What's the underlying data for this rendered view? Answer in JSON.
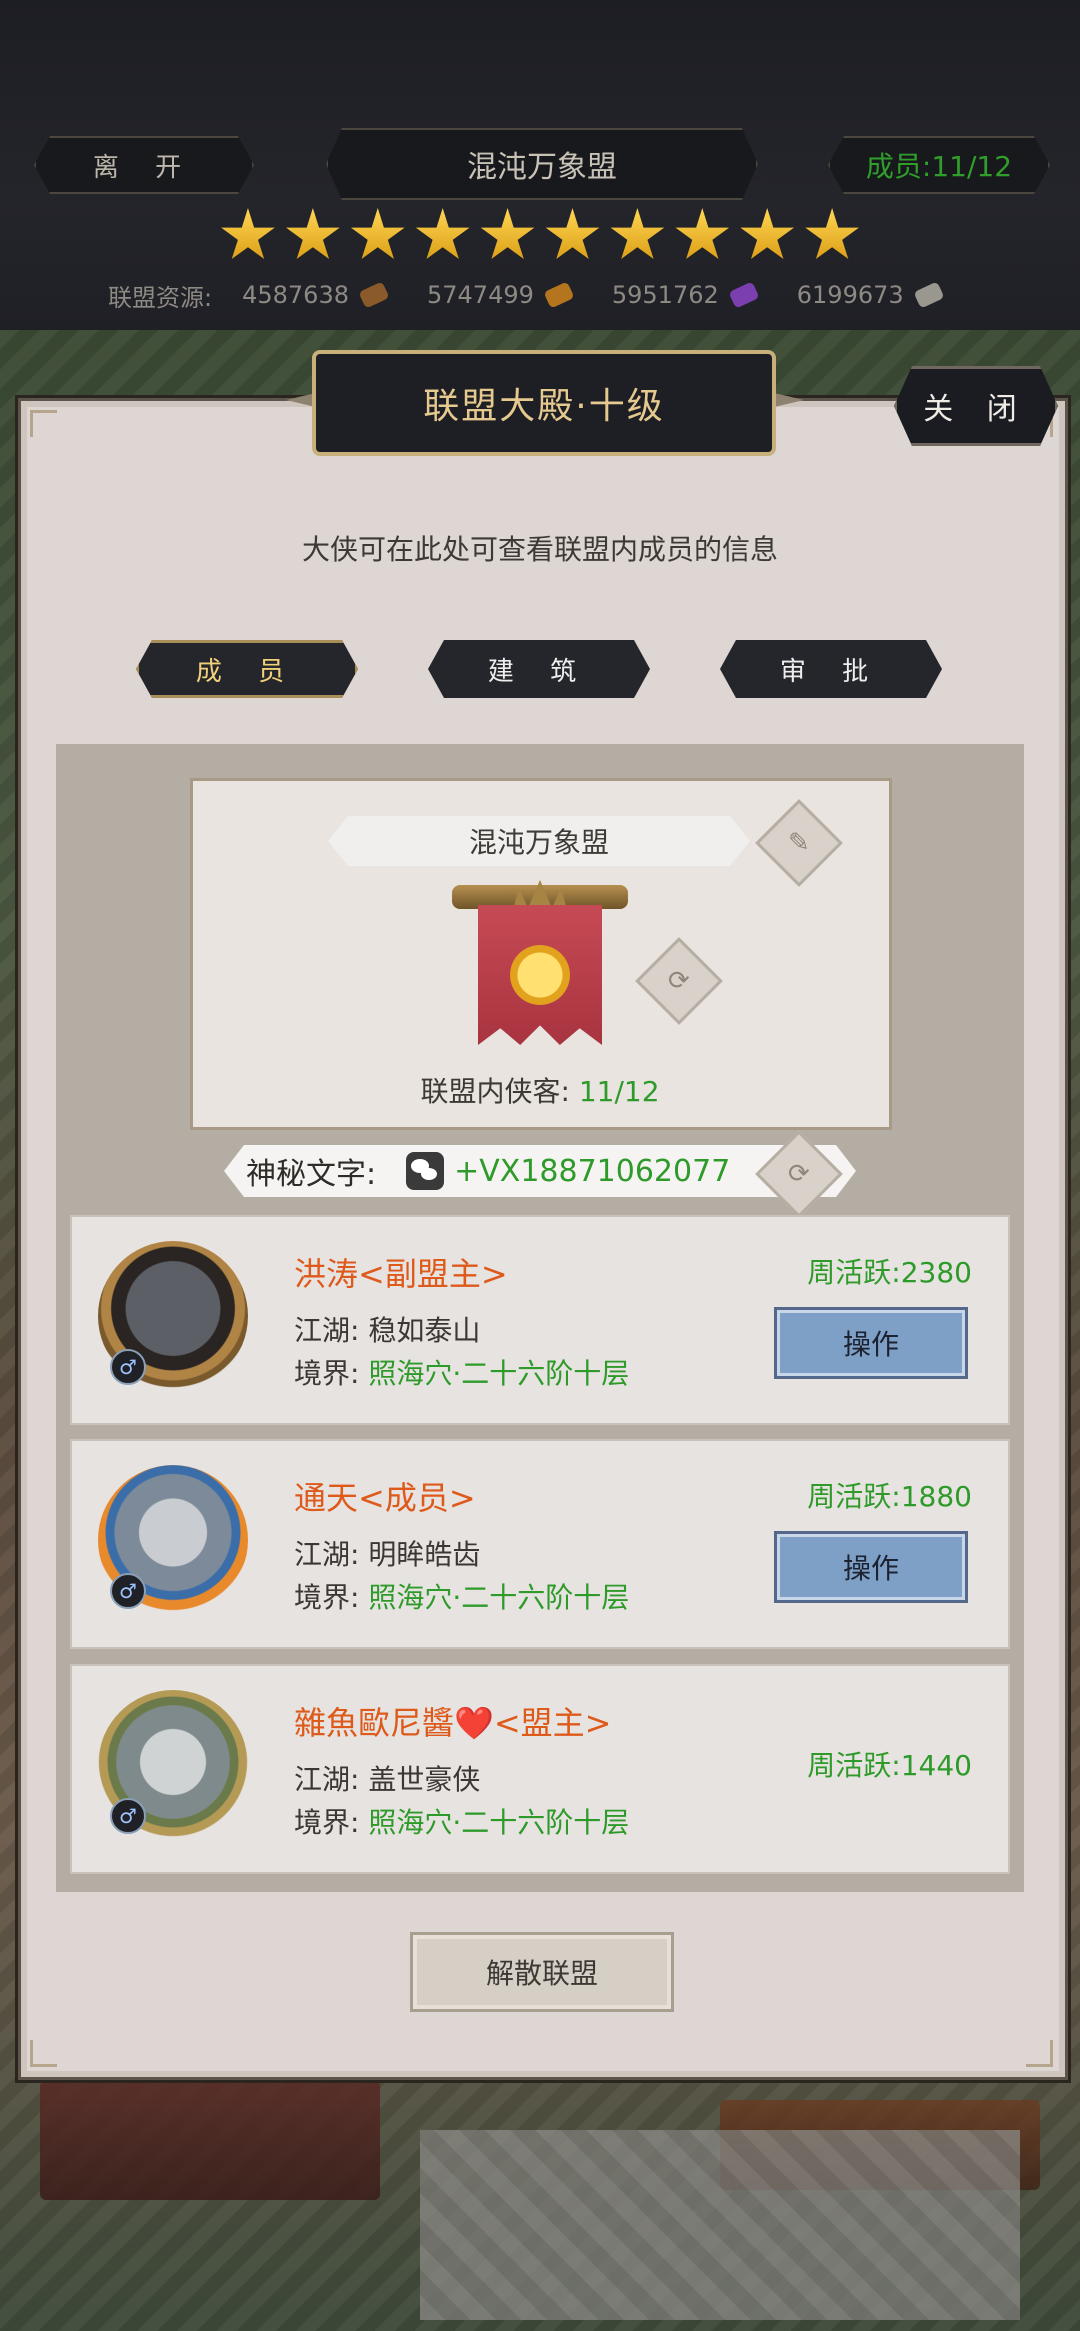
{
  "header": {
    "leave_label": "离 开",
    "alliance_name": "混沌万象盟",
    "member_count": "成员:11/12",
    "star_count": 10,
    "resources_label": "联盟资源:",
    "resources": [
      {
        "value": "4587638",
        "icon": "wood-icon"
      },
      {
        "value": "5747499",
        "icon": "grain-icon"
      },
      {
        "value": "5951762",
        "icon": "crystal-icon"
      },
      {
        "value": "6199673",
        "icon": "iron-icon"
      }
    ]
  },
  "panel": {
    "title": "联盟大殿·十级",
    "close_label": "关 闭",
    "description": "大侠可在此处可查看联盟内成员的信息",
    "tabs": [
      {
        "label": "成 员",
        "active": true
      },
      {
        "label": "建 筑",
        "active": false
      },
      {
        "label": "审 批",
        "active": false
      }
    ]
  },
  "alliance_card": {
    "name": "混沌万象盟",
    "roster_label": "联盟内侠客:",
    "roster_value": "11/12"
  },
  "secret": {
    "label": "神秘文字:",
    "value": "+VX18871062077"
  },
  "members": [
    {
      "name": "洪涛<副盟主>",
      "jianghu_label": "江湖:",
      "jianghu_value": "稳如泰山",
      "realm_label": "境界:",
      "realm_value": "照海穴·二十六阶十层",
      "activity": "周活跃:2380",
      "action_label": "操作",
      "gender_symbol": "♂"
    },
    {
      "name": "通天<成员>",
      "jianghu_label": "江湖:",
      "jianghu_value": "明眸皓齿",
      "realm_label": "境界:",
      "realm_value": "照海穴·二十六阶十层",
      "activity": "周活跃:1880",
      "action_label": "操作",
      "gender_symbol": "♂"
    },
    {
      "name": "雜魚歐尼醬❤️<盟主>",
      "jianghu_label": "江湖:",
      "jianghu_value": "盖世豪侠",
      "realm_label": "境界:",
      "realm_value": "照海穴·二十六阶十层",
      "activity": "周活跃:1440",
      "gender_symbol": "♂"
    }
  ],
  "footer": {
    "disband_label": "解散联盟"
  },
  "colors": {
    "accent_green": "#2e9a2a",
    "name_orange": "#de5a1b",
    "title_gold": "#e5c98e",
    "button_blue": "#7ea0c6"
  }
}
